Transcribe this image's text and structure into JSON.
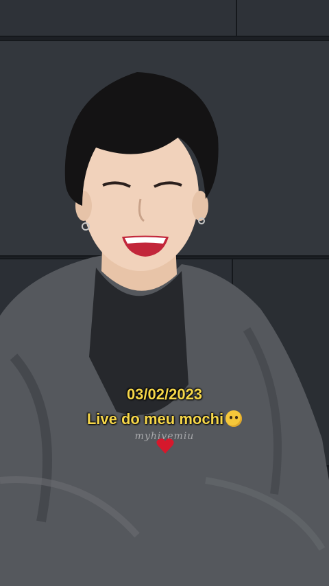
{
  "overlay": {
    "date": "03/02/2023",
    "caption": "Live do meu mochi",
    "caption_emoji": "crying-face-emoji",
    "watermark": "myhivemiu",
    "heart": "red-heart-emoji"
  },
  "colors": {
    "text_accent": "#f6d74a",
    "heart": "#d6182c",
    "wall": "#2e3238",
    "sweatshirt": "#55585d"
  }
}
